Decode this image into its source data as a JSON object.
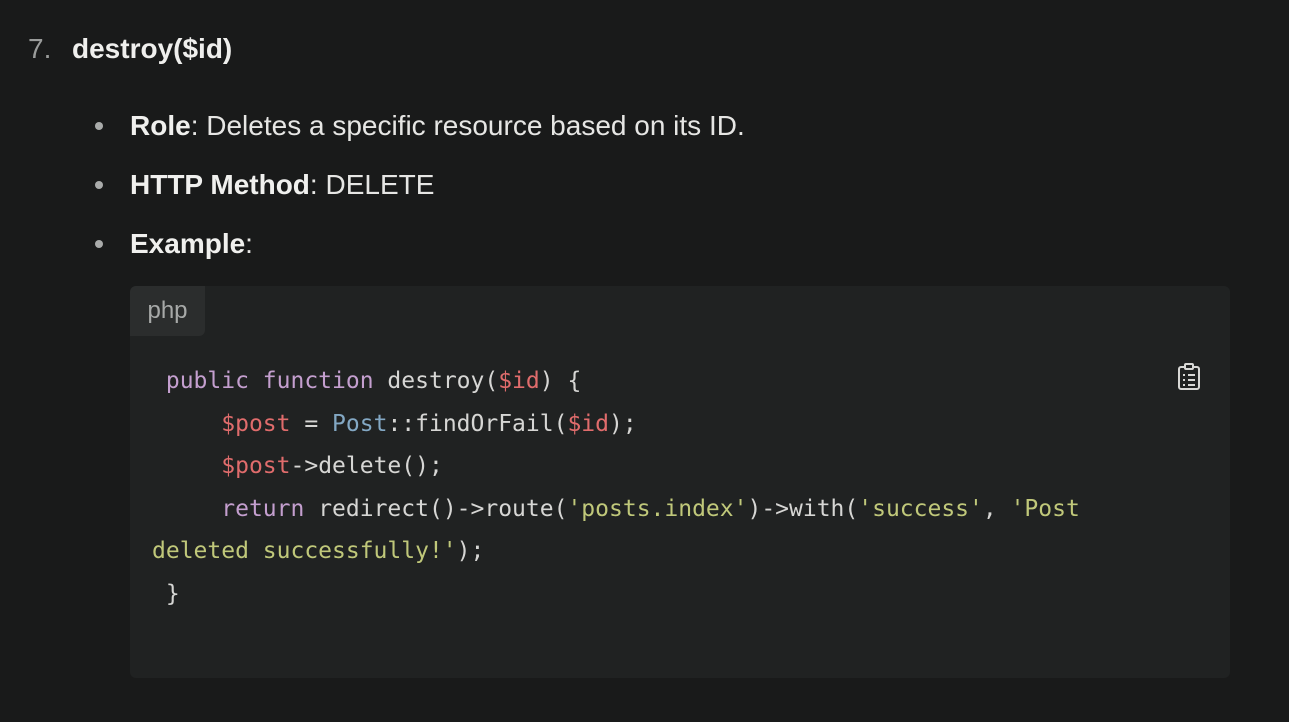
{
  "step": {
    "number": "7.",
    "title": "destroy($id)"
  },
  "bullets": [
    {
      "key": "Role",
      "sep": ": ",
      "value": "Deletes a specific resource based on its ID."
    },
    {
      "key": "HTTP Method",
      "sep": ": ",
      "value": "DELETE"
    },
    {
      "key": "Example",
      "sep": ":",
      "value": ""
    }
  ],
  "code_block": {
    "language": "php",
    "copy_icon": "clipboard-list-icon",
    "lines": {
      "l1": {
        "t1": " public",
        "t2": " ",
        "t3": "function",
        "t4": " destroy(",
        "t5": "$id",
        "t6": ") {"
      },
      "l2": {
        "t1": "     ",
        "t2": "$post",
        "t3": " = ",
        "t4": "Post",
        "t5": "::findOrFail(",
        "t6": "$id",
        "t7": ");"
      },
      "l3": {
        "t1": "     ",
        "t2": "$post",
        "t3": "->delete();"
      },
      "l4": {
        "t1": "     ",
        "t2": "return",
        "t3": " redirect()->route(",
        "t4": "'posts.index'",
        "t5": ")->with(",
        "t6": "'success'",
        "t7": ", ",
        "t8": "'Post"
      },
      "l5": {
        "t1": "deleted successfully!'",
        "t2": ");"
      },
      "l6": {
        "t1": " }"
      }
    }
  },
  "colors": {
    "background": "#191a1a",
    "code_background": "#202222",
    "keyword": "#c49fcf",
    "variable": "#e06c6c",
    "class": "#83a8c4",
    "string": "#c0c87a"
  }
}
